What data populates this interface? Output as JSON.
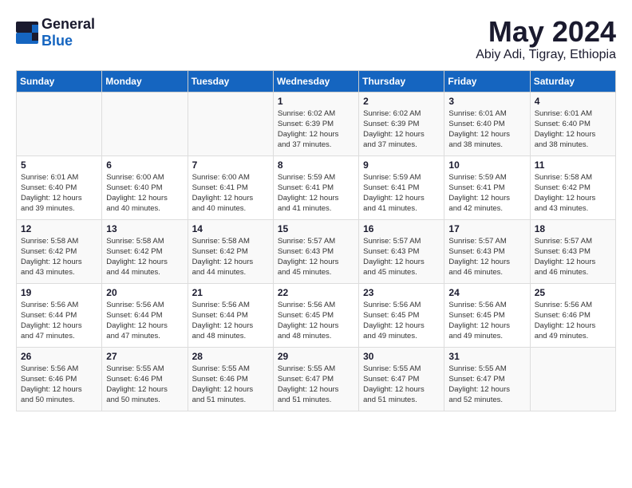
{
  "header": {
    "logo_general": "General",
    "logo_blue": "Blue",
    "month_year": "May 2024",
    "location": "Abiy Adi, Tigray, Ethiopia"
  },
  "weekdays": [
    "Sunday",
    "Monday",
    "Tuesday",
    "Wednesday",
    "Thursday",
    "Friday",
    "Saturday"
  ],
  "weeks": [
    [
      {
        "day": "",
        "info": ""
      },
      {
        "day": "",
        "info": ""
      },
      {
        "day": "",
        "info": ""
      },
      {
        "day": "1",
        "info": "Sunrise: 6:02 AM\nSunset: 6:39 PM\nDaylight: 12 hours\nand 37 minutes."
      },
      {
        "day": "2",
        "info": "Sunrise: 6:02 AM\nSunset: 6:39 PM\nDaylight: 12 hours\nand 37 minutes."
      },
      {
        "day": "3",
        "info": "Sunrise: 6:01 AM\nSunset: 6:40 PM\nDaylight: 12 hours\nand 38 minutes."
      },
      {
        "day": "4",
        "info": "Sunrise: 6:01 AM\nSunset: 6:40 PM\nDaylight: 12 hours\nand 38 minutes."
      }
    ],
    [
      {
        "day": "5",
        "info": "Sunrise: 6:01 AM\nSunset: 6:40 PM\nDaylight: 12 hours\nand 39 minutes."
      },
      {
        "day": "6",
        "info": "Sunrise: 6:00 AM\nSunset: 6:40 PM\nDaylight: 12 hours\nand 40 minutes."
      },
      {
        "day": "7",
        "info": "Sunrise: 6:00 AM\nSunset: 6:41 PM\nDaylight: 12 hours\nand 40 minutes."
      },
      {
        "day": "8",
        "info": "Sunrise: 5:59 AM\nSunset: 6:41 PM\nDaylight: 12 hours\nand 41 minutes."
      },
      {
        "day": "9",
        "info": "Sunrise: 5:59 AM\nSunset: 6:41 PM\nDaylight: 12 hours\nand 41 minutes."
      },
      {
        "day": "10",
        "info": "Sunrise: 5:59 AM\nSunset: 6:41 PM\nDaylight: 12 hours\nand 42 minutes."
      },
      {
        "day": "11",
        "info": "Sunrise: 5:58 AM\nSunset: 6:42 PM\nDaylight: 12 hours\nand 43 minutes."
      }
    ],
    [
      {
        "day": "12",
        "info": "Sunrise: 5:58 AM\nSunset: 6:42 PM\nDaylight: 12 hours\nand 43 minutes."
      },
      {
        "day": "13",
        "info": "Sunrise: 5:58 AM\nSunset: 6:42 PM\nDaylight: 12 hours\nand 44 minutes."
      },
      {
        "day": "14",
        "info": "Sunrise: 5:58 AM\nSunset: 6:42 PM\nDaylight: 12 hours\nand 44 minutes."
      },
      {
        "day": "15",
        "info": "Sunrise: 5:57 AM\nSunset: 6:43 PM\nDaylight: 12 hours\nand 45 minutes."
      },
      {
        "day": "16",
        "info": "Sunrise: 5:57 AM\nSunset: 6:43 PM\nDaylight: 12 hours\nand 45 minutes."
      },
      {
        "day": "17",
        "info": "Sunrise: 5:57 AM\nSunset: 6:43 PM\nDaylight: 12 hours\nand 46 minutes."
      },
      {
        "day": "18",
        "info": "Sunrise: 5:57 AM\nSunset: 6:43 PM\nDaylight: 12 hours\nand 46 minutes."
      }
    ],
    [
      {
        "day": "19",
        "info": "Sunrise: 5:56 AM\nSunset: 6:44 PM\nDaylight: 12 hours\nand 47 minutes."
      },
      {
        "day": "20",
        "info": "Sunrise: 5:56 AM\nSunset: 6:44 PM\nDaylight: 12 hours\nand 47 minutes."
      },
      {
        "day": "21",
        "info": "Sunrise: 5:56 AM\nSunset: 6:44 PM\nDaylight: 12 hours\nand 48 minutes."
      },
      {
        "day": "22",
        "info": "Sunrise: 5:56 AM\nSunset: 6:45 PM\nDaylight: 12 hours\nand 48 minutes."
      },
      {
        "day": "23",
        "info": "Sunrise: 5:56 AM\nSunset: 6:45 PM\nDaylight: 12 hours\nand 49 minutes."
      },
      {
        "day": "24",
        "info": "Sunrise: 5:56 AM\nSunset: 6:45 PM\nDaylight: 12 hours\nand 49 minutes."
      },
      {
        "day": "25",
        "info": "Sunrise: 5:56 AM\nSunset: 6:46 PM\nDaylight: 12 hours\nand 49 minutes."
      }
    ],
    [
      {
        "day": "26",
        "info": "Sunrise: 5:56 AM\nSunset: 6:46 PM\nDaylight: 12 hours\nand 50 minutes."
      },
      {
        "day": "27",
        "info": "Sunrise: 5:55 AM\nSunset: 6:46 PM\nDaylight: 12 hours\nand 50 minutes."
      },
      {
        "day": "28",
        "info": "Sunrise: 5:55 AM\nSunset: 6:46 PM\nDaylight: 12 hours\nand 51 minutes."
      },
      {
        "day": "29",
        "info": "Sunrise: 5:55 AM\nSunset: 6:47 PM\nDaylight: 12 hours\nand 51 minutes."
      },
      {
        "day": "30",
        "info": "Sunrise: 5:55 AM\nSunset: 6:47 PM\nDaylight: 12 hours\nand 51 minutes."
      },
      {
        "day": "31",
        "info": "Sunrise: 5:55 AM\nSunset: 6:47 PM\nDaylight: 12 hours\nand 52 minutes."
      },
      {
        "day": "",
        "info": ""
      }
    ]
  ]
}
